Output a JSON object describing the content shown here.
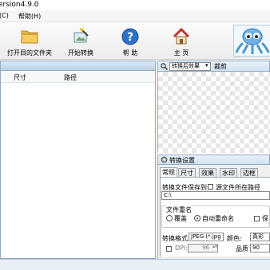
{
  "window": {
    "title": "ersion4.9.0"
  },
  "menu": {
    "items": [
      "(C)",
      "帮助(H)"
    ]
  },
  "toolbar": {
    "open_folder": "打开目的文件夹",
    "start_convert": "开始转换",
    "help": "帮 助",
    "home": "主 页"
  },
  "file_list": {
    "columns": [
      "尺寸",
      "路径"
    ]
  },
  "preview": {
    "mode_select": "转换后效果",
    "tab_label": "裁剪"
  },
  "settings": {
    "title": "转换设置",
    "tabs": [
      "常规",
      "尺寸",
      "效果",
      "水印",
      "边框"
    ],
    "save_to_label": "转换文件保存到:",
    "source_folder_checkbox": "源文件所在路径",
    "save_path_value": "C:\\",
    "rename_group_label": "文件重名",
    "overwrite_label": "覆盖",
    "auto_rename_label": "自动重命名",
    "keep_label": "保",
    "format_label": "转换格式:",
    "format_value": "JPEG (*.jpg",
    "color_label": "颜色:",
    "color_value": "真彩",
    "dpi_label": "DPI:",
    "dpi_value": "96",
    "quality_label": "品质",
    "quality_value": "90"
  },
  "colors": {
    "accent": "#8fa9c2",
    "background": "#f0f0f0"
  }
}
